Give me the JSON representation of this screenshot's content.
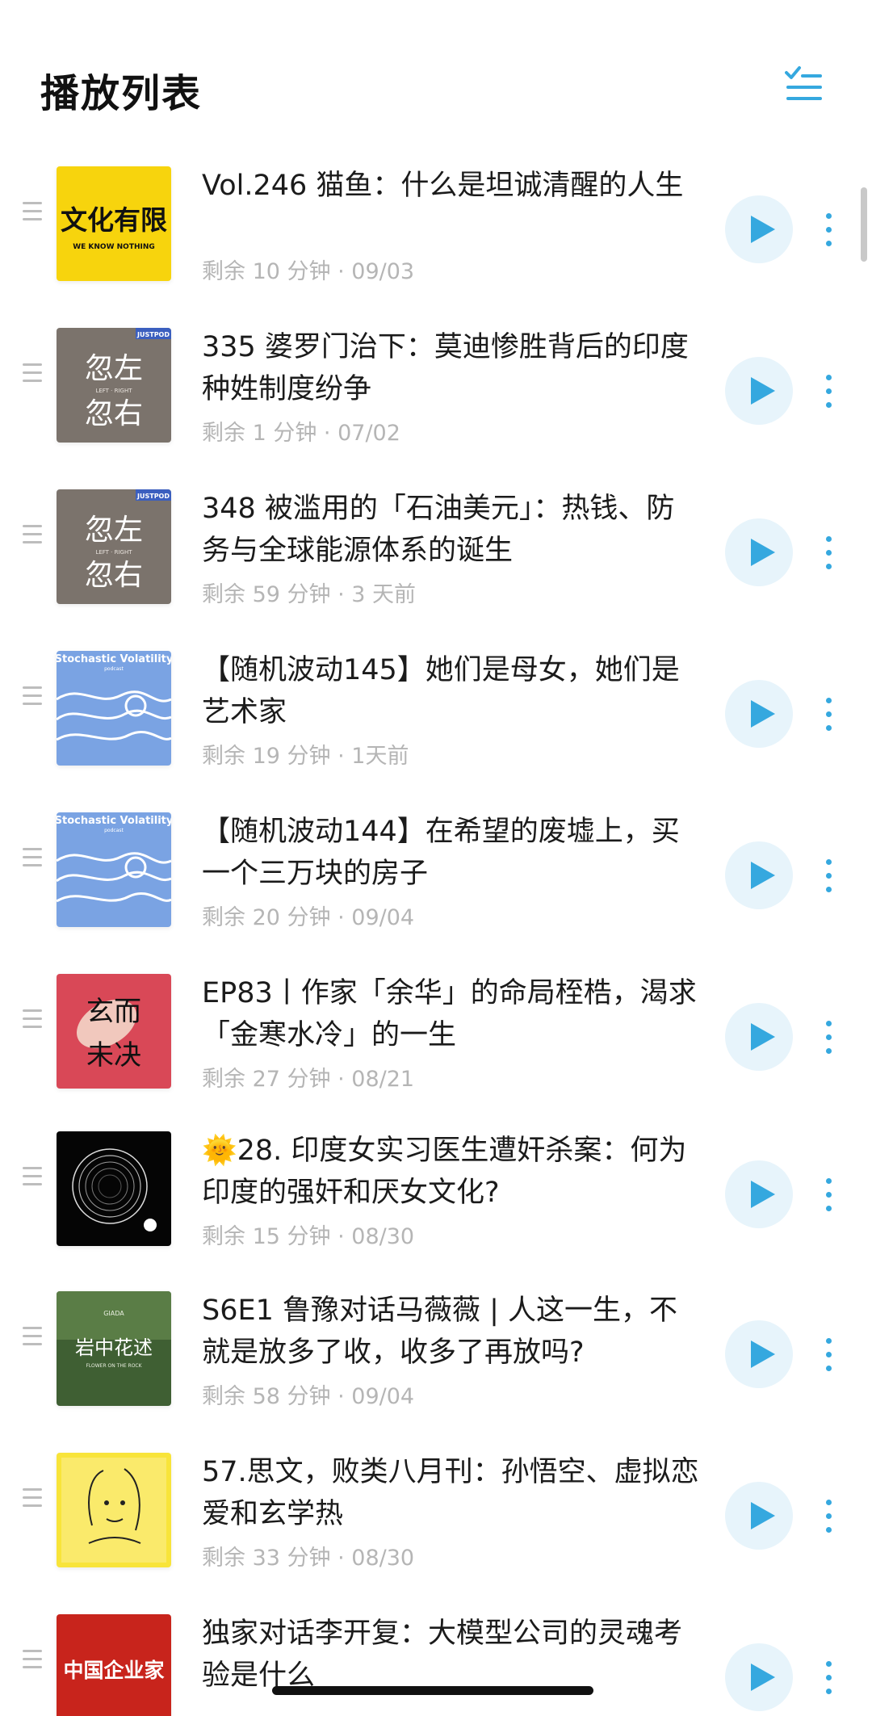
{
  "header": {
    "title": "播放列表",
    "icon": "sort-list-icon",
    "accent": "#35a8df"
  },
  "episodes": [
    {
      "title": "Vol.246 猫鱼：什么是坦诚清醒的人生",
      "meta": "剩余 10 分钟 · 09/03",
      "cover": "wenhua-youxian"
    },
    {
      "title": "335 婆罗门治下：莫迪惨胜背后的印度种姓制度纷争",
      "meta": "剩余 1 分钟 · 07/02",
      "cover": "huzuo-huyou"
    },
    {
      "title": "348 被滥用的「石油美元」：热钱、防务与全球能源体系的诞生",
      "meta": "剩余 59 分钟 · 3 天前",
      "cover": "huzuo-huyou"
    },
    {
      "title": "【随机波动145】她们是母女，她们是艺术家",
      "meta": "剩余 19 分钟 · 1天前",
      "cover": "stochastic-volatility"
    },
    {
      "title": "【随机波动144】在希望的废墟上，买一个三万块的房子",
      "meta": "剩余 20 分钟 · 09/04",
      "cover": "stochastic-volatility"
    },
    {
      "title": "EP83丨作家「余华」的命局桎梏，渴求「金寒水冷」的一生",
      "meta": "剩余 27 分钟 · 08/21",
      "cover": "xuaner-weijue"
    },
    {
      "title": "🌞28. 印度女实习医生遭奸杀案：何为印度的强奸和厌女文化?",
      "meta": "剩余 15 分钟 · 08/30",
      "cover": "black-sphere"
    },
    {
      "title": "S6E1 鲁豫对话马薇薇 | 人这一生，不就是放多了收，收多了再放吗?",
      "meta": "剩余 58 分钟 · 09/04",
      "cover": "yanzhong-huashu"
    },
    {
      "title": "57.思文，败类八月刊：孙悟空、虚拟恋爱和玄学热",
      "meta": "剩余 33 分钟 · 08/30",
      "cover": "yellow-drawing"
    },
    {
      "title": "独家对话李开复：大模型公司的灵魂考验是什么",
      "meta": "",
      "cover": "zhongguo-qiyejia"
    }
  ],
  "covers": {
    "wenhua_main": "文化有限",
    "wenhua_sub": "WE KNOW NOTHING",
    "huzuo_top": "忽左",
    "huzuo_mid": "LEFT · RIGHT",
    "huzuo_bottom": "忽右",
    "justpod": "JUSTPOD",
    "stochastic_title": "Stochastic Volatility",
    "stochastic_sub": "podcast",
    "xuaner_top": "玄而",
    "xuaner_bottom": "未决",
    "yanzhong_top": "GIADA",
    "yanzhong_main": "岩中花述",
    "yanzhong_sub": "FLOWER ON THE ROCK",
    "qiyejia_main": "中国企业家"
  }
}
